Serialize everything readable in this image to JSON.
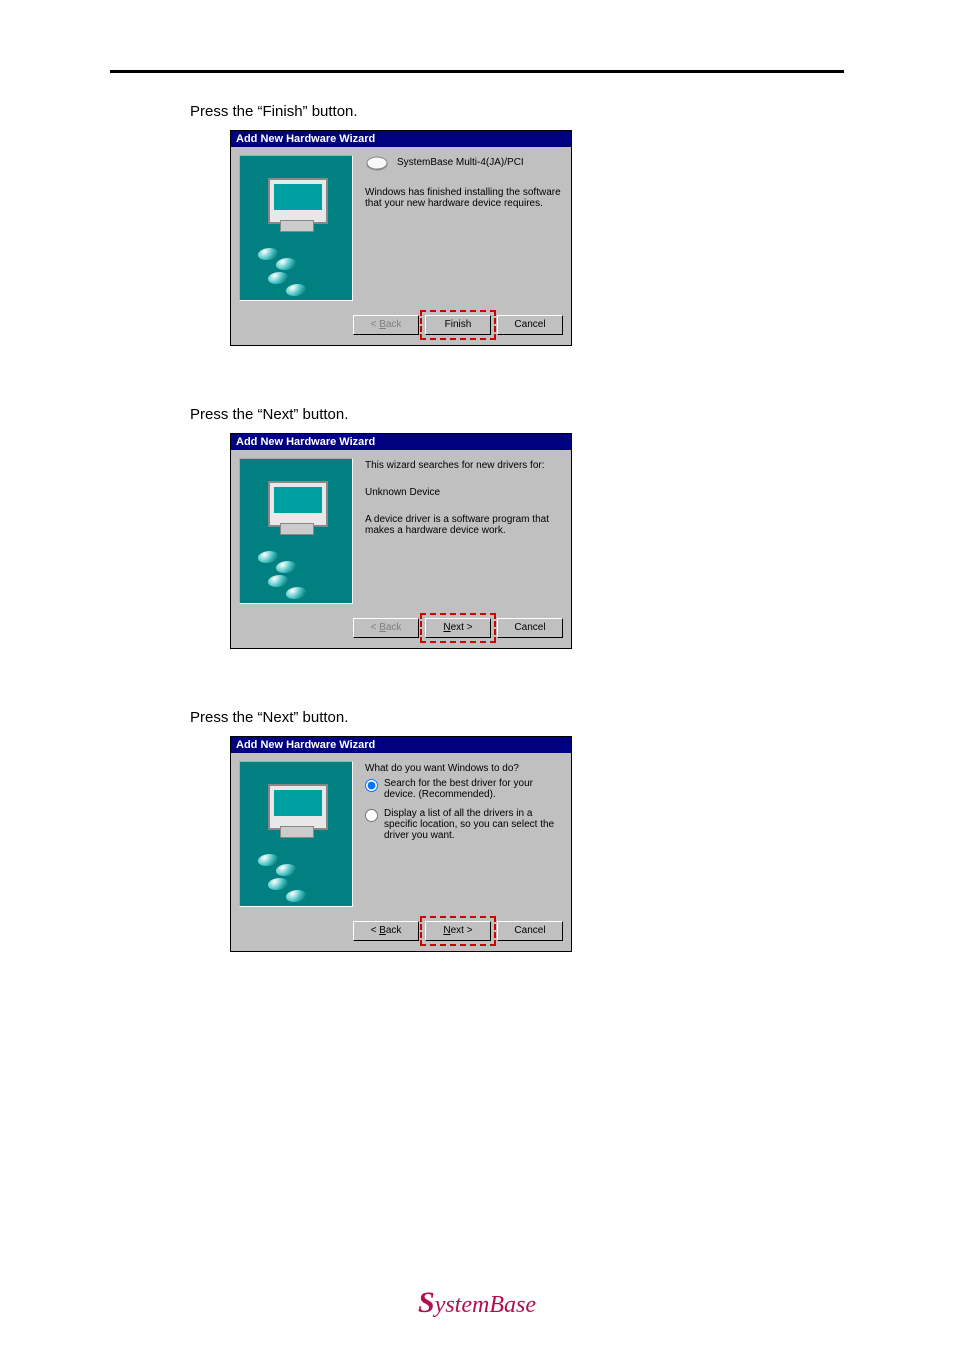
{
  "instructions": {
    "i1": "Press the “Finish” button.",
    "i2": "Press the “Next” button.",
    "i3": "Press the “Next” button."
  },
  "dialog_title": "Add New Hardware Wizard",
  "dialog1": {
    "line1": "SystemBase Multi-4(JA)/PCI",
    "line2": "Windows has finished installing the software that your new hardware device requires."
  },
  "dialog2": {
    "line1": "This wizard searches for new drivers for:",
    "line2": "Unknown Device",
    "line3": "A device driver is a software program that makes a hardware device work."
  },
  "dialog3": {
    "prompt": "What do you want Windows to do?",
    "opt1": "Search for the best driver for your device. (Recommended).",
    "opt2": "Display a list of all the drivers in a specific location, so you can select the driver you want."
  },
  "buttons": {
    "back_label_prefix": "< ",
    "back_letter": "B",
    "back_rest": "ack",
    "finish": "Finish",
    "next_letter": "N",
    "next_rest": "ext >",
    "cancel": "Cancel"
  },
  "footer": {
    "brand": "SystemBase"
  }
}
